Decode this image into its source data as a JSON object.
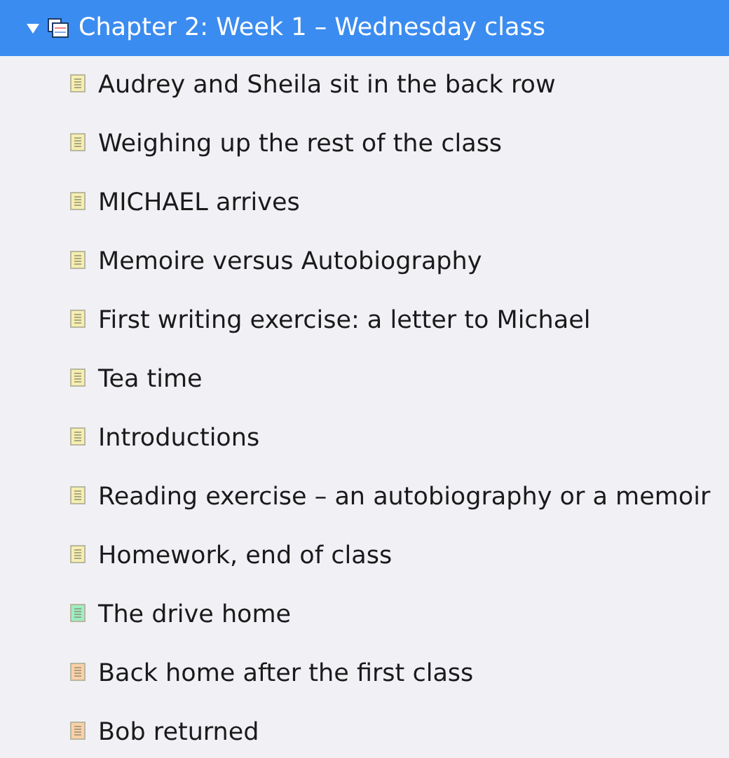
{
  "folder": {
    "title": "Chapter 2: Week 1 – Wednesday class",
    "selected": true,
    "expanded": true,
    "children": [
      {
        "title": "Audrey and Sheila sit in the back row",
        "color": "#f6eeb0"
      },
      {
        "title": "Weighing up the rest of the class",
        "color": "#f6eeb0"
      },
      {
        "title": "MICHAEL arrives",
        "color": "#f6eeb0"
      },
      {
        "title": "Memoire versus Autobiography",
        "color": "#f6eeb0"
      },
      {
        "title": "First writing exercise: a letter to Michael",
        "color": "#f6eeb0"
      },
      {
        "title": "Tea time",
        "color": "#f6eeb0"
      },
      {
        "title": "Introductions",
        "color": "#f6eeb0"
      },
      {
        "title": "Reading exercise – an autobiography or a memoir",
        "color": "#f6eeb0"
      },
      {
        "title": "Homework, end of class",
        "color": "#f6eeb0"
      },
      {
        "title": "The drive home",
        "color": "#9eeec4"
      },
      {
        "title": "Back home after the first class",
        "color": "#fcd0a8"
      },
      {
        "title": "Bob returned",
        "color": "#fcd0a8"
      }
    ]
  }
}
